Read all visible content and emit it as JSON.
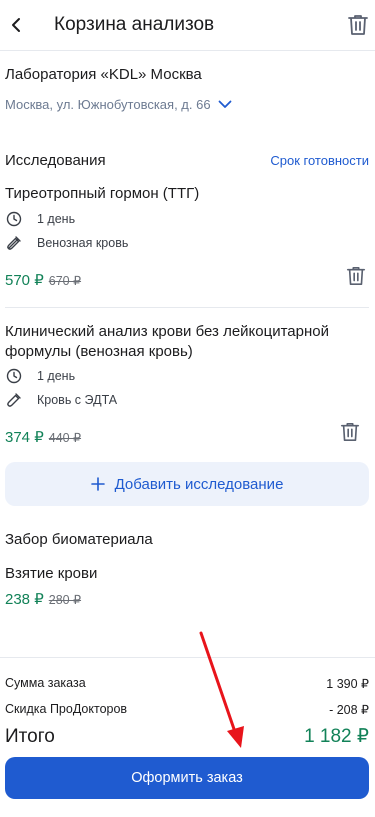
{
  "header": {
    "title": "Корзина анализов",
    "back_icon": "chevron-left-icon",
    "trash_icon": "trash-icon"
  },
  "lab": {
    "name": "Лаборатория «KDL» Москва",
    "address": "Москва, ул. Южнобутовская, д. 66",
    "address_icon": "chevron-down-icon"
  },
  "tests": {
    "section_title": "Исследования",
    "ready_link": "Срок готовности",
    "items": [
      {
        "name": "Тиреотропный гормон (ТТГ)",
        "duration": "1 день",
        "material": "Венозная кровь",
        "price": "570 ₽",
        "old_price": "670 ₽"
      },
      {
        "name": "Клинический анализ крови без лейкоцитарной формулы (венозная кровь)",
        "duration": "1 день",
        "material": "Кровь с ЭДТА",
        "price": "374 ₽",
        "old_price": "440 ₽"
      }
    ],
    "add_button": "Добавить исследование"
  },
  "biomaterial": {
    "section_title": "Забор биоматериала",
    "name": "Взятие крови",
    "price": "238 ₽",
    "old_price": "280 ₽"
  },
  "summary": {
    "order_sum_label": "Сумма заказа",
    "order_sum_value": "1 390 ₽",
    "discount_label": "Скидка ПроДокторов",
    "discount_value": "- 208 ₽",
    "total_label": "Итого",
    "total_value": "1 182 ₽",
    "order_button": "Оформить заказ"
  },
  "colors": {
    "accent": "#1f5bd0",
    "price_green": "#128258",
    "annotation_arrow": "#e8141b"
  }
}
